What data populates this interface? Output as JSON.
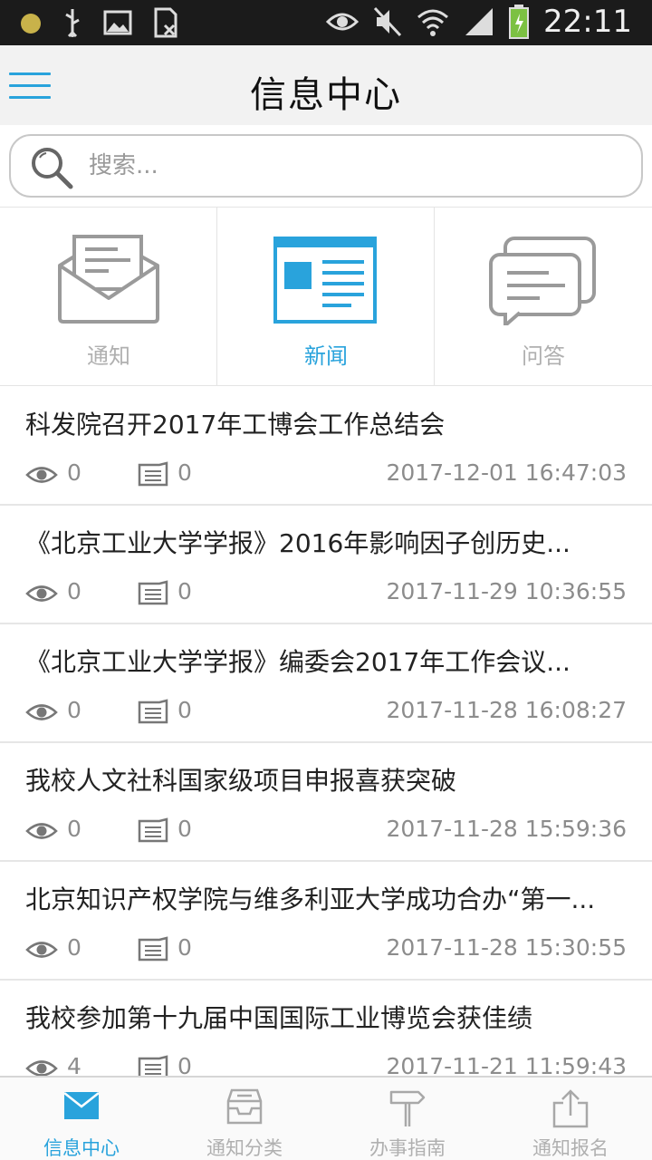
{
  "status_bar": {
    "time": "22:11",
    "icons": [
      "notification-dot-icon",
      "usb-icon",
      "image-icon",
      "sim-icon",
      "eye-icon",
      "mute-icon",
      "wifi-icon",
      "signal-icon",
      "battery-icon"
    ]
  },
  "header": {
    "title": "信息中心",
    "menu_icon": "hamburger-menu-icon"
  },
  "search": {
    "placeholder": "搜索...",
    "icon": "search-icon"
  },
  "categories": [
    {
      "label": "通知",
      "icon": "envelope-icon",
      "active": false
    },
    {
      "label": "新闻",
      "icon": "newspaper-icon",
      "active": true
    },
    {
      "label": "问答",
      "icon": "chat-bubbles-icon",
      "active": false
    }
  ],
  "news": [
    {
      "title": "科发院召开2017年工博会工作总结会",
      "views": "0",
      "comments": "0",
      "date": "2017-12-01 16:47:03"
    },
    {
      "title": "《北京工业大学学报》2016年影响因子创历史...",
      "views": "0",
      "comments": "0",
      "date": "2017-11-29 10:36:55"
    },
    {
      "title": "《北京工业大学学报》编委会2017年工作会议...",
      "views": "0",
      "comments": "0",
      "date": "2017-11-28 16:08:27"
    },
    {
      "title": "我校人文社科国家级项目申报喜获突破",
      "views": "0",
      "comments": "0",
      "date": "2017-11-28 15:59:36"
    },
    {
      "title": "北京知识产权学院与维多利亚大学成功合办“第一...",
      "views": "0",
      "comments": "0",
      "date": "2017-11-28 15:30:55"
    },
    {
      "title": "我校参加第十九届中国国际工业博览会获佳绩",
      "views": "4",
      "comments": "0",
      "date": "2017-11-21 11:59:43"
    }
  ],
  "bottom_nav": [
    {
      "label": "信息中心",
      "icon": "mail-icon",
      "active": true
    },
    {
      "label": "通知分类",
      "icon": "inbox-tray-icon",
      "active": false
    },
    {
      "label": "办事指南",
      "icon": "signpost-icon",
      "active": false
    },
    {
      "label": "通知报名",
      "icon": "share-upload-icon",
      "active": false
    }
  ],
  "colors": {
    "accent": "#29a3dc",
    "inactive": "#b0b0b0",
    "status_bar": "#1b1b1b"
  }
}
